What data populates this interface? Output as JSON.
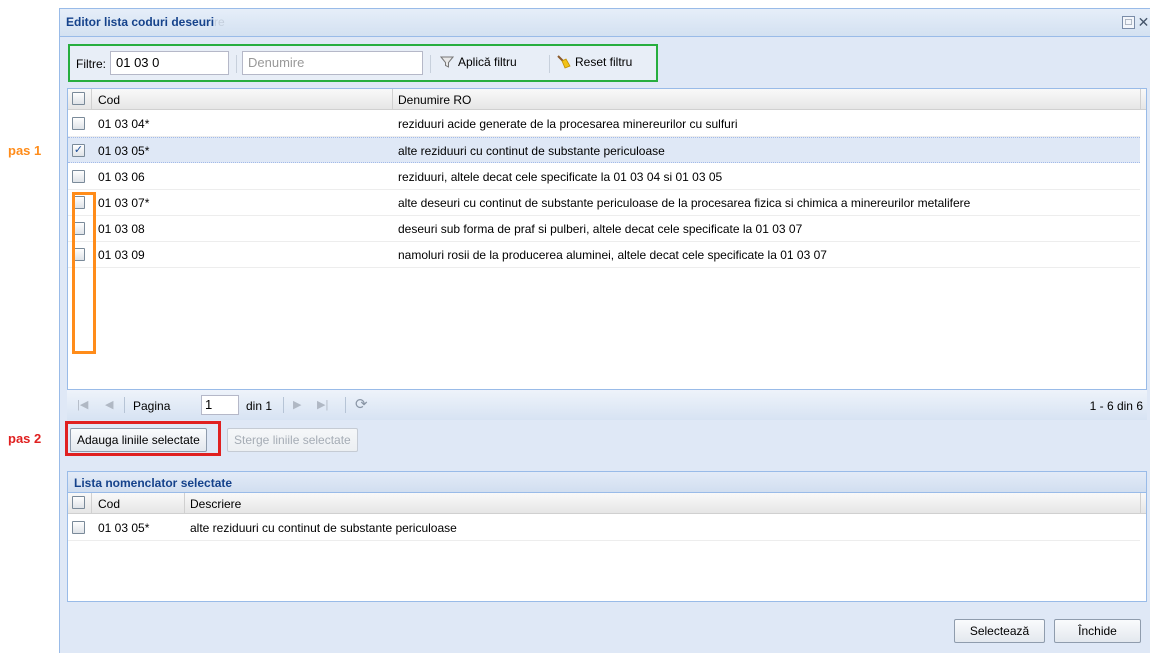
{
  "annotations": {
    "pas1": "pas 1",
    "pas2": "pas 2",
    "colors": {
      "pas1": "#ff8c1a",
      "pas2": "#e02020",
      "filter_box": "#27ae3f"
    }
  },
  "window": {
    "title": "Editor lista coduri deseuri",
    "title_ghost": "re"
  },
  "filter": {
    "label": "Filtre:",
    "code_value": "01 03 0",
    "name_placeholder": "Denumire",
    "apply_label": "Aplică filtru",
    "reset_label": "Reset filtru"
  },
  "grid": {
    "columns": [
      "Cod",
      "Denumire RO"
    ],
    "rows": [
      {
        "cod": "01 03 04*",
        "denumire": "reziduuri acide generate de la procesarea minereurilor cu sulfuri",
        "checked": false
      },
      {
        "cod": "01 03 05*",
        "denumire": "alte reziduuri cu continut de substante periculoase",
        "checked": true
      },
      {
        "cod": "01 03 06",
        "denumire": "reziduuri, altele decat cele specificate la 01 03 04 si 01 03 05",
        "checked": false
      },
      {
        "cod": "01 03 07*",
        "denumire": "alte deseuri cu continut de substante periculoase de la procesarea fizica si chimica a minereurilor metalifere",
        "checked": false
      },
      {
        "cod": "01 03 08",
        "denumire": "deseuri sub forma de praf si pulberi, altele decat cele specificate la 01 03 07",
        "checked": false
      },
      {
        "cod": "01 03 09",
        "denumire": "namoluri rosii de la producerea aluminei, altele decat cele specificate la 01 03 07",
        "checked": false
      }
    ]
  },
  "pager": {
    "page_label": "Pagina",
    "page_value": "1",
    "of_label": "din 1",
    "summary": "1 - 6 din 6"
  },
  "actions": {
    "add_label": "Adauga liniile selectate",
    "remove_label": "Sterge liniile selectate"
  },
  "selected": {
    "title": "Lista nomenclator selectate",
    "columns": [
      "Cod",
      "Descriere"
    ],
    "rows": [
      {
        "cod": "01 03 05*",
        "descriere": "alte reziduuri cu continut de substante periculoase",
        "checked": false
      }
    ]
  },
  "footer": {
    "select_label": "Selectează",
    "close_label": "Închide"
  }
}
